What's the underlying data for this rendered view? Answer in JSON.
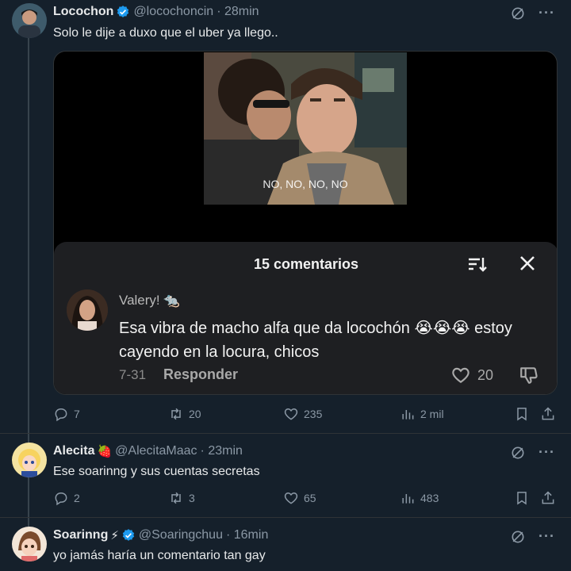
{
  "tweets": [
    {
      "name": "Locochon",
      "handle": "@locochoncin",
      "time": "· 28min",
      "text": "Solo le dije a duxo que el uber ya llego..",
      "verified": true,
      "media": {
        "caption": "NO, NO, NO, NO",
        "comments": {
          "title": "15 comentarios",
          "user": "Valery!",
          "user_emoji": "🐀",
          "text": "Esa vibra de macho alfa que da locochón 😭😭😭 estoy cayendo en la locura, chicos",
          "date": "7-31",
          "reply_label": "Responder",
          "likes": "20"
        }
      },
      "actions": {
        "replies": "7",
        "retweets": "20",
        "likes": "235",
        "views": "2 mil"
      }
    },
    {
      "name": "Alecita",
      "name_emoji": "🍓",
      "handle": "@AlecitaMaac",
      "time": "· 23min",
      "text": "Ese soarinng y sus cuentas secretas",
      "verified": false,
      "actions": {
        "replies": "2",
        "retweets": "3",
        "likes": "65",
        "views": "483"
      }
    },
    {
      "name": "Soarinng",
      "name_emoji": "⚡",
      "handle": "@Soaringchuu",
      "time": "· 16min",
      "text": "yo jamás haría un comentario tan gay",
      "verified": true
    }
  ],
  "icons": {
    "verified": "verified-badge-icon",
    "grok": "grok-icon",
    "more": "more-icon",
    "reply": "reply-icon",
    "retweet": "retweet-icon",
    "like": "heart-icon",
    "views": "views-icon",
    "bookmark": "bookmark-icon",
    "share": "share-icon"
  },
  "more_glyph": "···",
  "colors": {
    "background": "#15202b",
    "text": "#e7e9ea",
    "muted": "#8b98a5",
    "verified": "#1d9bf0",
    "panel": "#1e1f22"
  }
}
